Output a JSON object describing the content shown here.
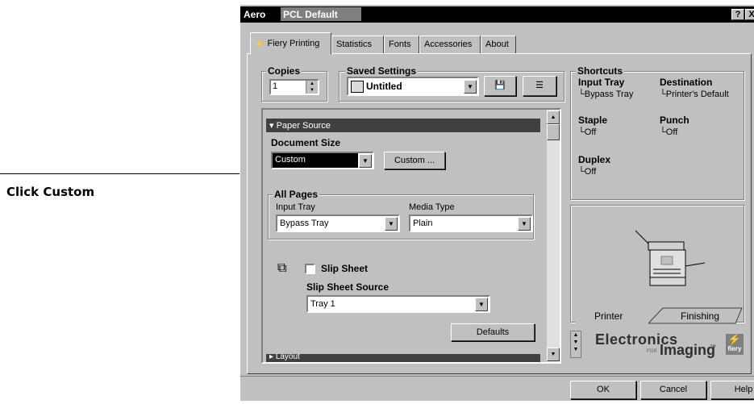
{
  "callout": {
    "text": "Click Custom"
  },
  "window": {
    "title": "Aero",
    "title_selected": "PCL Default",
    "help_button": "?",
    "close_button": "X"
  },
  "tabs": [
    "Fiery Printing",
    "Statistics",
    "Fonts",
    "Accessories",
    "About"
  ],
  "copies": {
    "label": "Copies",
    "value": "1"
  },
  "saved_settings": {
    "label": "Saved Settings",
    "value": "Untitled"
  },
  "panel": {
    "section_title": "Paper Source",
    "document_size_label": "Document Size",
    "document_size_value": "Custom",
    "custom_button": "Custom ...",
    "all_pages_label": "All Pages",
    "input_tray_label": "Input Tray",
    "input_tray_value": "Bypass Tray",
    "media_type_label": "Media Type",
    "media_type_value": "Plain",
    "slip_sheet_label": "Slip Sheet",
    "slip_sheet_source_label": "Slip Sheet Source",
    "slip_sheet_source_value": "Tray 1",
    "defaults_button": "Defaults",
    "next_section": "Layout"
  },
  "shortcuts": {
    "label": "Shortcuts",
    "input_tray_label": "Input Tray",
    "input_tray_value": "Bypass Tray",
    "destination_label": "Destination",
    "destination_value": "Printer's Default",
    "staple_label": "Staple",
    "staple_value": "Off",
    "punch_label": "Punch",
    "punch_value": "Off",
    "duplex_label": "Duplex",
    "duplex_value": "Off"
  },
  "printer_view": {
    "tab_printer": "Printer",
    "tab_finishing": "Finishing"
  },
  "branding": {
    "line1": "Electronics",
    "line2": "Imaging",
    "for_text": "FOR",
    "tm": "™",
    "logo": "fiery"
  },
  "footer": {
    "ok": "OK",
    "cancel": "Cancel",
    "help": "Help"
  },
  "icons": [
    "fiery-lightning-icon",
    "printer-icon",
    "save-icon",
    "list-icon",
    "slip-sheet-icon",
    "printer-illustration-icon"
  ]
}
